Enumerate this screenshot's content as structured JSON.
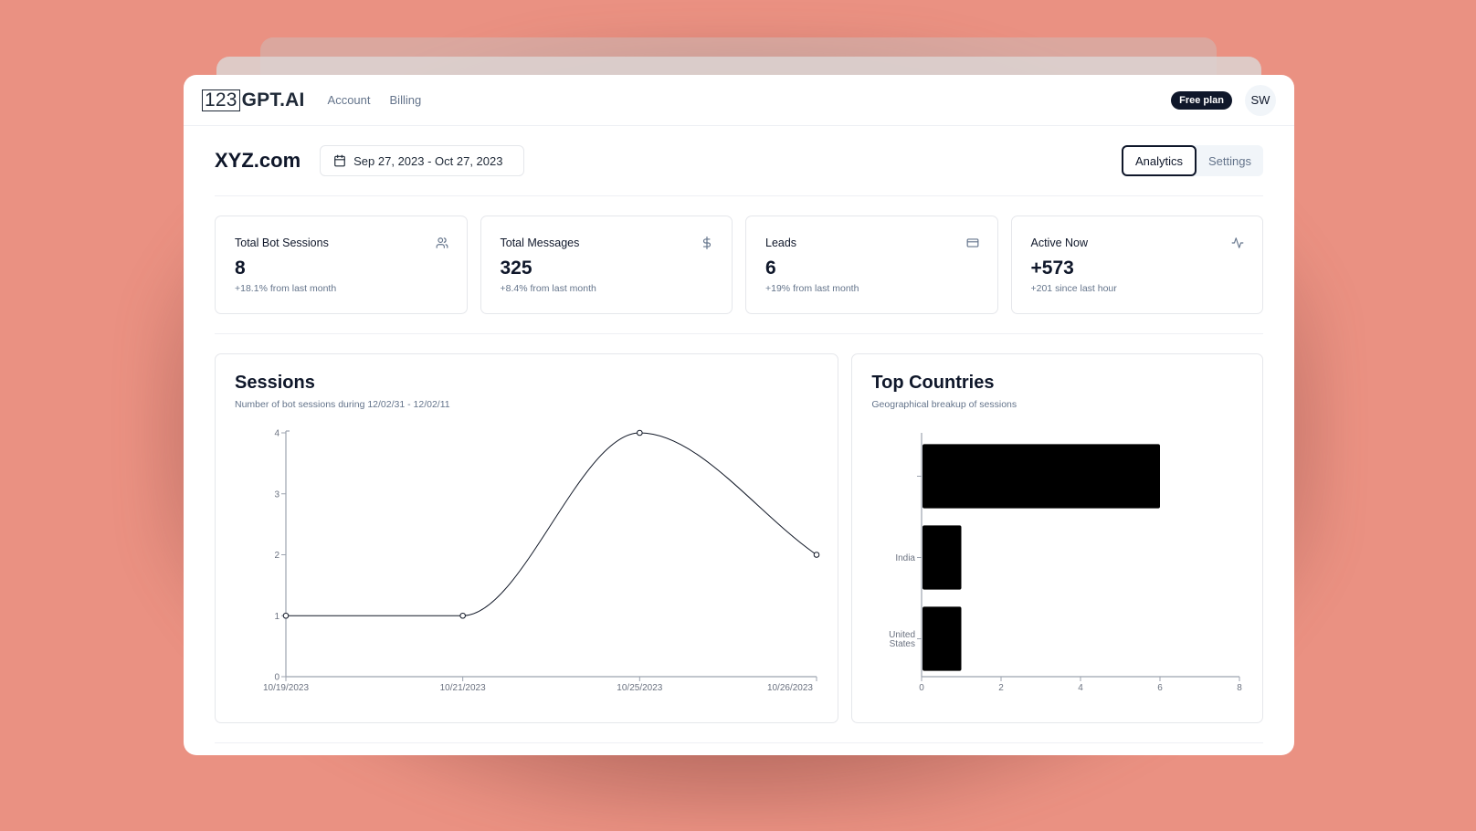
{
  "nav": {
    "logo_box": "123",
    "logo_rest": "GPT.AI",
    "links": [
      "Account",
      "Billing"
    ],
    "plan_badge": "Free plan",
    "avatar_initials": "SW"
  },
  "header": {
    "site_title": "XYZ.com",
    "date_range": "Sep 27, 2023 - Oct 27, 2023",
    "tabs": [
      {
        "label": "Analytics",
        "active": true
      },
      {
        "label": "Settings",
        "active": false
      }
    ]
  },
  "stats": [
    {
      "title": "Total Bot Sessions",
      "value": "8",
      "sub": "+18.1% from last month",
      "icon": "users-icon"
    },
    {
      "title": "Total Messages",
      "value": "325",
      "sub": "+8.4% from last month",
      "icon": "dollar-icon"
    },
    {
      "title": "Leads",
      "value": "6",
      "sub": "+19% from last month",
      "icon": "credit-card-icon"
    },
    {
      "title": "Active Now",
      "value": "+573",
      "sub": "+201 since last hour",
      "icon": "activity-icon"
    }
  ],
  "chart_data": [
    {
      "type": "line",
      "title": "Sessions",
      "subtitle": "Number of bot sessions during 12/02/31 - 12/02/11",
      "x": [
        "10/19/2023",
        "10/21/2023",
        "10/25/2023",
        "10/26/2023"
      ],
      "values": [
        1,
        1,
        4,
        2
      ],
      "yticks": [
        0,
        1,
        2,
        3,
        4
      ],
      "ylim": [
        0,
        4
      ],
      "xlabel": "",
      "ylabel": "",
      "grid": false,
      "curve": "monotone"
    },
    {
      "type": "bar",
      "orientation": "horizontal",
      "title": "Top Countries",
      "subtitle": "Geographical breakup of sessions",
      "categories": [
        "",
        "India",
        "United States"
      ],
      "values": [
        6,
        1,
        1
      ],
      "xticks": [
        0,
        2,
        4,
        6,
        8
      ],
      "xlim": [
        0,
        8
      ],
      "xlabel": "",
      "ylabel": "",
      "grid": false
    }
  ]
}
